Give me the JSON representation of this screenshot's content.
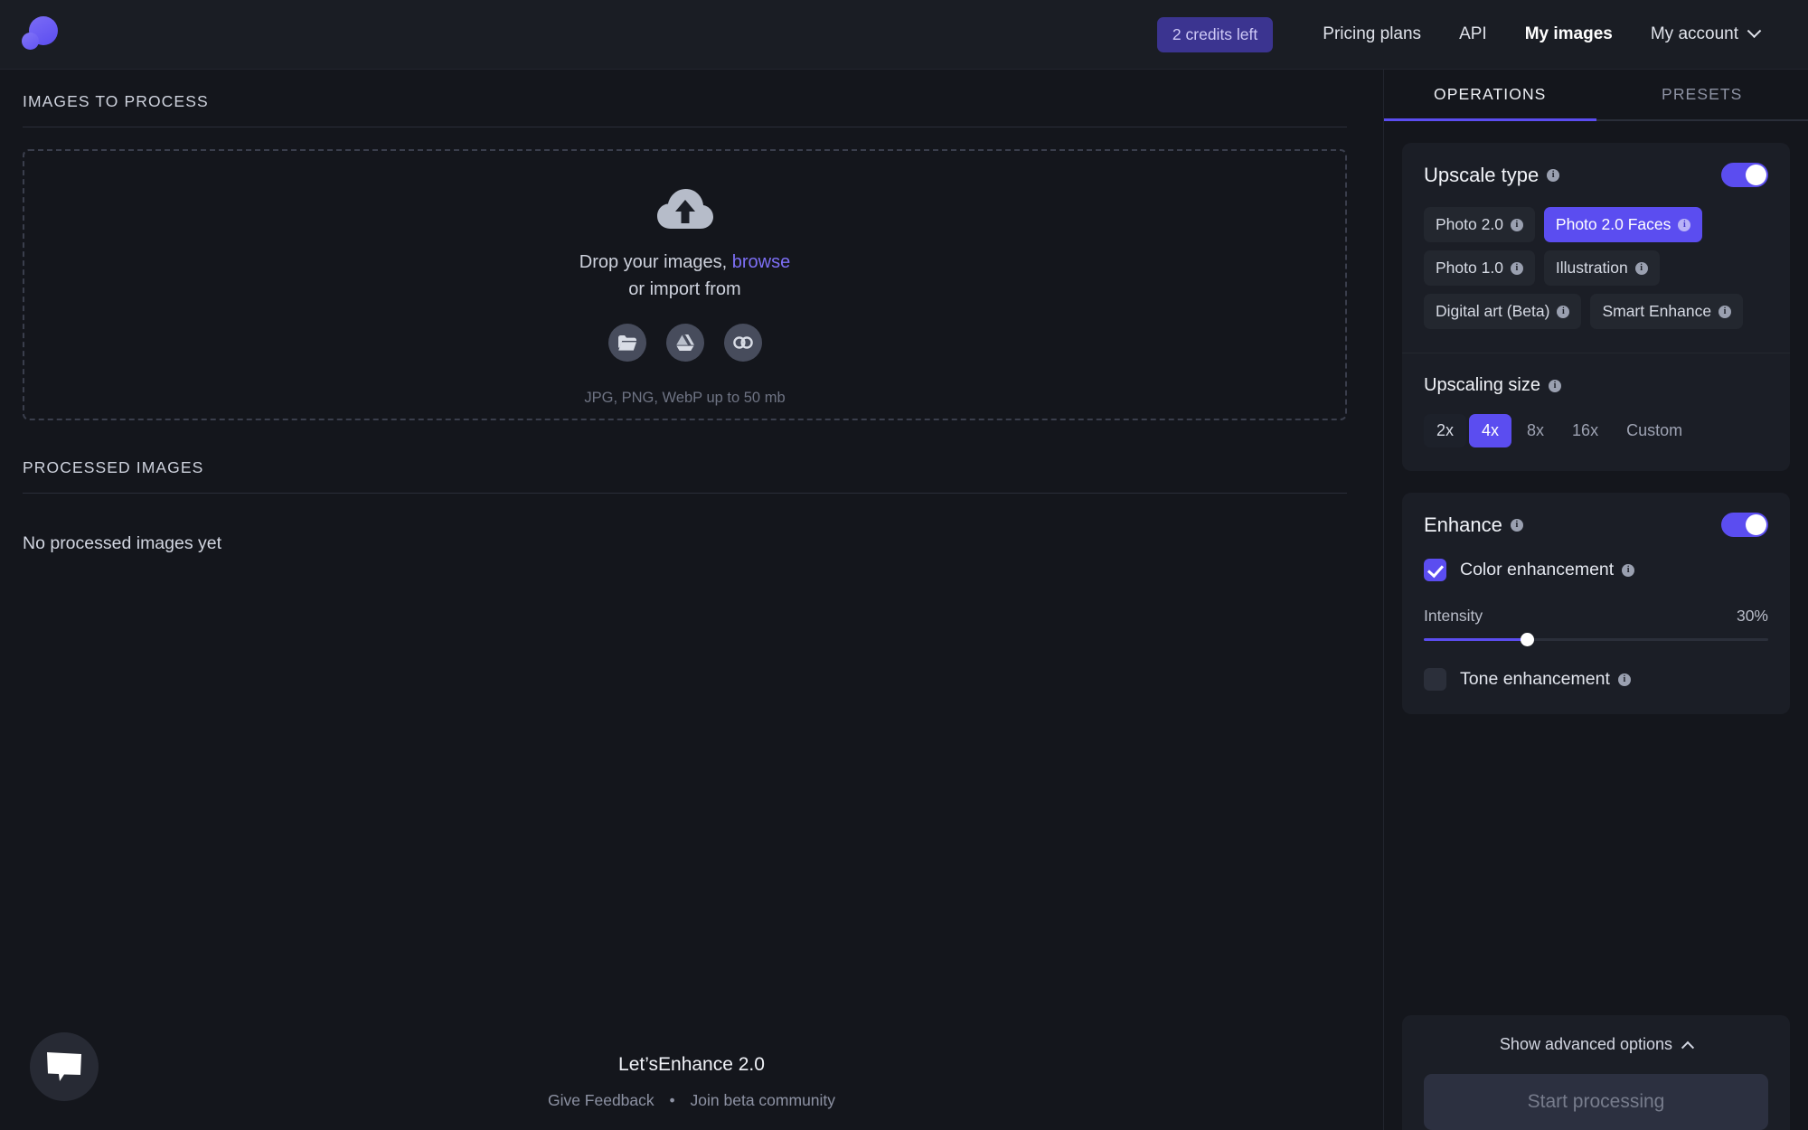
{
  "header": {
    "logo_icon": "letsenhance-logo-icon",
    "credits": "2 credits left",
    "nav": [
      {
        "label": "Pricing plans",
        "strong": false
      },
      {
        "label": "API",
        "strong": false
      },
      {
        "label": "My images",
        "strong": true
      }
    ],
    "account_label": "My account",
    "chevron_icon": "chevron-down-icon"
  },
  "left": {
    "images_to_process_title": "IMAGES TO PROCESS",
    "dropzone": {
      "cloud_icon": "cloud-upload-icon",
      "drop_text_prefix": "Drop your images, ",
      "browse_label": "browse",
      "import_text": "or import from",
      "import_buttons": [
        {
          "icon": "folder-icon",
          "name": "import-from-computer"
        },
        {
          "icon": "google-drive-icon",
          "name": "import-from-google-drive"
        },
        {
          "icon": "link-icon",
          "name": "import-from-url"
        }
      ],
      "hint": "JPG, PNG, WebP up to 50 mb"
    },
    "processed_images_title": "PROCESSED IMAGES",
    "processed_empty": "No processed images yet"
  },
  "footer": {
    "title": "Let’sEnhance 2.0",
    "feedback_label": "Give Feedback",
    "separator": "•",
    "community_label": "Join beta community",
    "chat_icon": "chat-bubble-icon"
  },
  "right": {
    "tabs": [
      {
        "label": "OPERATIONS",
        "active": true
      },
      {
        "label": "PRESETS",
        "active": false
      }
    ],
    "upscale": {
      "title": "Upscale type",
      "info_icon": "info-icon",
      "toggle_on": true,
      "chips": [
        {
          "label": "Photo 2.0",
          "selected": false
        },
        {
          "label": "Photo 2.0 Faces",
          "selected": true
        },
        {
          "label": "Photo 1.0",
          "selected": false
        },
        {
          "label": "Illustration",
          "selected": false
        },
        {
          "label": "Digital art (Beta)",
          "selected": false
        },
        {
          "label": "Smart Enhance",
          "selected": false
        }
      ],
      "size_title": "Upscaling size",
      "sizes": [
        {
          "label": "2x",
          "state": "alt"
        },
        {
          "label": "4x",
          "state": "sel"
        },
        {
          "label": "8x",
          "state": "plain"
        },
        {
          "label": "16x",
          "state": "plain"
        },
        {
          "label": "Custom",
          "state": "plain"
        }
      ]
    },
    "enhance": {
      "title": "Enhance",
      "toggle_on": true,
      "color_enhancement_label": "Color enhancement",
      "color_enhancement_checked": true,
      "intensity_label": "Intensity",
      "intensity_value": "30%",
      "intensity_percent": 30,
      "tone_enhancement_label": "Tone enhancement",
      "tone_enhancement_checked": false
    },
    "advanced_label": "Show advanced options",
    "advanced_chevron": "chevron-up-icon",
    "start_button_label": "Start processing"
  },
  "colors": {
    "accent": "#5b4df0",
    "page_bg": "#14161c",
    "card_bg": "#1b1e26",
    "chip_bg": "#23272f"
  }
}
